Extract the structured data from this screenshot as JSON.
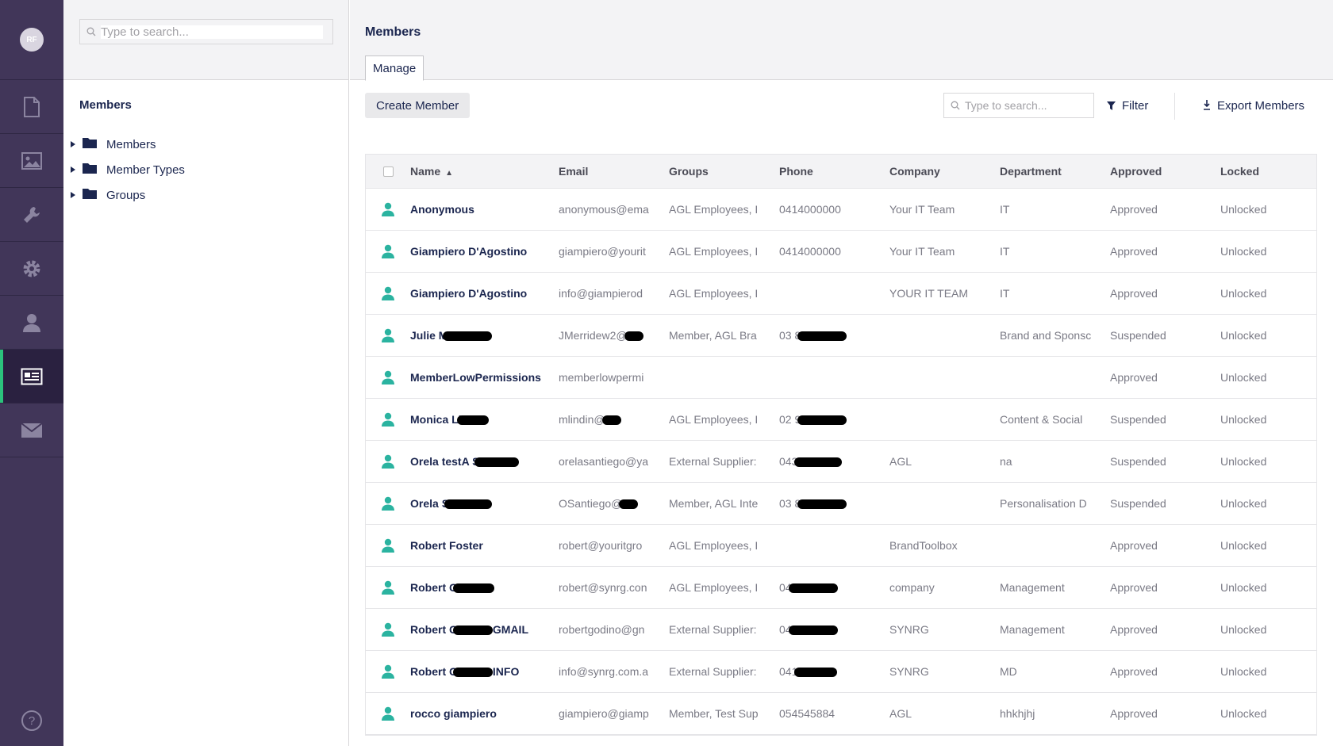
{
  "rail": {
    "avatar_initials": "RF",
    "sections": [
      "content",
      "media",
      "settings-tools",
      "settings",
      "users",
      "members",
      "forms"
    ],
    "active": "members"
  },
  "tree": {
    "search_placeholder": "Type to search...",
    "title": "Members",
    "nodes": [
      {
        "label": "Members"
      },
      {
        "label": "Member Types"
      },
      {
        "label": "Groups"
      }
    ]
  },
  "main": {
    "title": "Members",
    "tab": "Manage",
    "toolbar": {
      "create_label": "Create Member",
      "search_placeholder": "Type to search...",
      "filter_label": "Filter",
      "export_label": "Export Members"
    },
    "table": {
      "headers": {
        "name": "Name",
        "email": "Email",
        "groups": "Groups",
        "phone": "Phone",
        "company": "Company",
        "department": "Department",
        "approved": "Approved",
        "locked": "Locked"
      },
      "rows": [
        {
          "name": "Anonymous",
          "email": "anonymous@ema",
          "groups": "AGL Employees, I",
          "phone": "0414000000",
          "company": "Your IT Team",
          "department": "IT",
          "approved": "Approved",
          "locked": "Unlocked"
        },
        {
          "name": "Giampiero D'Agostino",
          "email": "giampiero@yourit",
          "groups": "AGL Employees, I",
          "phone": "0414000000",
          "company": "Your IT Team",
          "department": "IT",
          "approved": "Approved",
          "locked": "Unlocked"
        },
        {
          "name": "Giampiero D'Agostino",
          "email": "info@giampierod",
          "groups": "AGL Employees, I",
          "phone": "",
          "company": "YOUR IT TEAM",
          "department": "IT",
          "approved": "Approved",
          "locked": "Unlocked"
        },
        {
          "name": "Julie M",
          "email": "JMerridew2@",
          "groups": "Member, AGL Bra",
          "phone": "03 8",
          "company": "",
          "department": "Brand and Sponsc",
          "approved": "Suspended",
          "locked": "Unlocked"
        },
        {
          "name": "MemberLowPermissions",
          "email": "memberlowpermi",
          "groups": "",
          "phone": "",
          "company": "",
          "department": "",
          "approved": "Approved",
          "locked": "Unlocked"
        },
        {
          "name": "Monica Li",
          "email": "mlindin@",
          "groups": "AGL Employees, I",
          "phone": "02 9",
          "company": "",
          "department": "Content & Social",
          "approved": "Suspended",
          "locked": "Unlocked"
        },
        {
          "name": "Orela testA S",
          "email": "orelasantiego@ya",
          "groups": "External Supplier:",
          "phone": "043",
          "company": "AGL",
          "department": "na",
          "approved": "Suspended",
          "locked": "Unlocked"
        },
        {
          "name": "Orela S",
          "email": "OSantiego@",
          "groups": "Member, AGL Inte",
          "phone": "03 8",
          "company": "",
          "department": "Personalisation D",
          "approved": "Suspended",
          "locked": "Unlocked"
        },
        {
          "name": "Robert Foster",
          "email": "robert@youritgro",
          "groups": "AGL Employees, I",
          "phone": "",
          "company": "BrandToolbox",
          "department": "",
          "approved": "Approved",
          "locked": "Unlocked"
        },
        {
          "name": "Robert G",
          "email": "robert@synrg.con",
          "groups": "AGL Employees, I",
          "phone": "04",
          "company": "company",
          "department": "Management",
          "approved": "Approved",
          "locked": "Unlocked"
        },
        {
          "name": "Robert G GMAIL",
          "email": "robertgodino@gn",
          "groups": "External Supplier:",
          "phone": "04",
          "company": "SYNRG",
          "department": "Management",
          "approved": "Approved",
          "locked": "Unlocked"
        },
        {
          "name": "Robert G INFO",
          "email": "info@synrg.com.a",
          "groups": "External Supplier:",
          "phone": "041",
          "company": "SYNRG",
          "department": "MD",
          "approved": "Approved",
          "locked": "Unlocked"
        },
        {
          "name": "rocco giampiero",
          "email": "giampiero@giamp",
          "groups": "Member, Test Sup",
          "phone": "054545884",
          "company": "AGL",
          "department": "hhkhjhj",
          "approved": "Approved",
          "locked": "Unlocked"
        }
      ]
    }
  },
  "colors": {
    "rail_bg": "#413659",
    "active_accent": "#2bc37c",
    "member_icon": "#2bb3a0",
    "header_bg": "#f3f3f5"
  }
}
